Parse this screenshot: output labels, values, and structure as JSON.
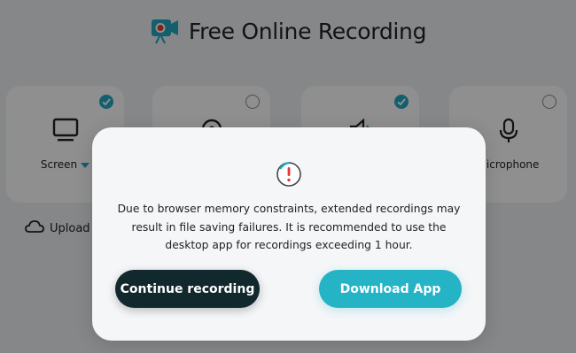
{
  "app": {
    "title": "Free Online Recording",
    "icon": "camera-record-icon",
    "brand_color": "#22a9c4"
  },
  "sources": [
    {
      "label": "Screen",
      "icon": "monitor-icon",
      "selected": true,
      "has_dropdown": true
    },
    {
      "label": "",
      "icon": "webcam-icon",
      "selected": false,
      "has_dropdown": false
    },
    {
      "label": "",
      "icon": "speaker-icon",
      "selected": true,
      "has_dropdown": false
    },
    {
      "label": "Microphone",
      "icon": "microphone-icon",
      "selected": false,
      "has_dropdown": false
    }
  ],
  "upload": {
    "label": "Upload t",
    "icon": "cloud-icon"
  },
  "modal": {
    "icon": "warning-icon",
    "message": "Due to browser memory constraints, extended recordings may result in file saving failures. It is recommended to use the desktop app for recordings exceeding 1 hour.",
    "continue_label": "Continue recording",
    "download_label": "Download App",
    "colors": {
      "continue_bg": "#11282c",
      "download_bg": "#25b3c6",
      "warning_red": "#e53935"
    }
  }
}
